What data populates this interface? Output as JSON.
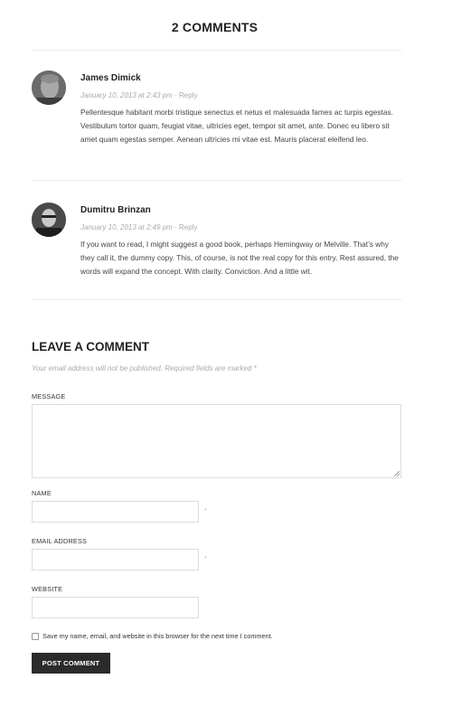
{
  "comments_section": {
    "title": "2 COMMENTS",
    "items": [
      {
        "author": "James Dimick",
        "date": "January 10, 2013 at 2:43 pm",
        "separator": "·",
        "reply_label": "Reply",
        "text": "Pellentesque habitant morbi tristique senectus et netus et malesuada fames ac turpis egestas. Vestibulum tortor quam, feugiat vitae, ultricies eget, tempor sit amet, ante. Donec eu libero sit amet quam egestas semper. Aenean ultricies mi vitae est. Mauris placerat eleifend leo."
      },
      {
        "author": "Dumitru Brinzan",
        "date": "January 10, 2013 at 2:49 pm",
        "separator": "·",
        "reply_label": "Reply",
        "text": "If you want to read, I might suggest a good book, perhaps Hemingway or Melville. That’s why they call it, the dummy copy. This, of course, is not the real copy for this entry. Rest assured, the words will expand the concept. With clarity. Conviction. And a little wit."
      }
    ]
  },
  "comment_form": {
    "title": "LEAVE A COMMENT",
    "note": "Your email address will not be published. Required fields are marked *",
    "message_label": "MESSAGE",
    "message_value": "",
    "name_label": "NAME",
    "name_value": "",
    "email_label": "EMAIL ADDRESS",
    "email_value": "",
    "website_label": "WEBSITE",
    "website_value": "",
    "required_mark": "*",
    "save_info_label": "Save my name, email, and website in this browser for the next time I comment.",
    "save_info_checked": false,
    "submit_label": "POST COMMENT"
  },
  "colors": {
    "button_bg": "#2b2b2b",
    "border": "#dcdcdc",
    "muted_text": "#aaaaaa"
  }
}
